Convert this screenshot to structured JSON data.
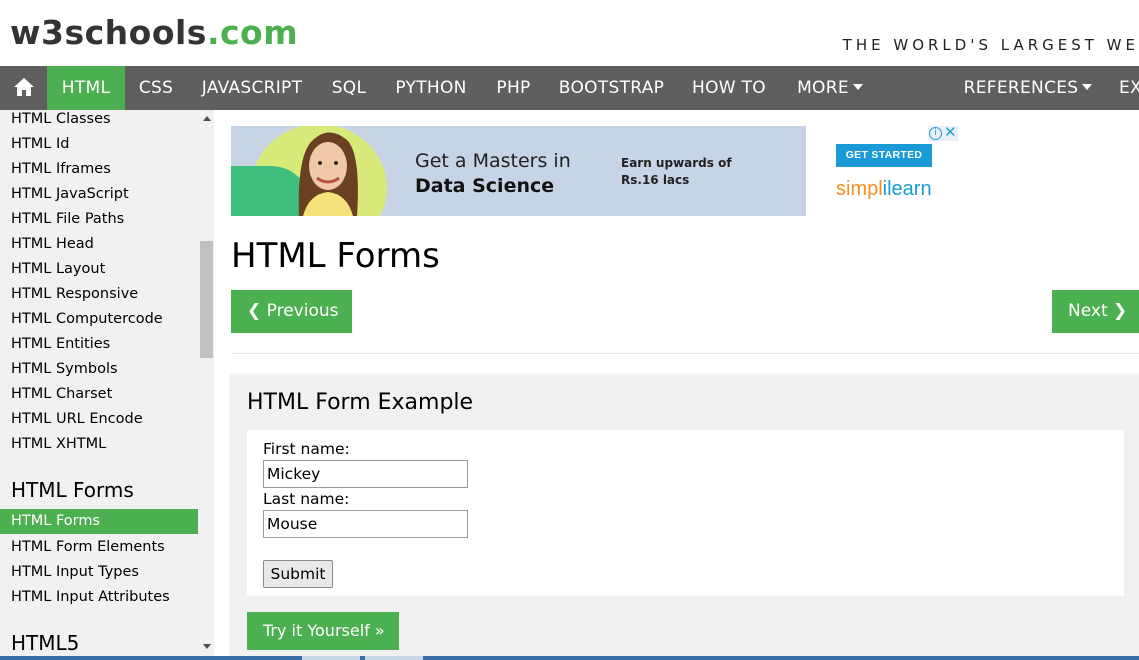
{
  "brand": {
    "logo_main": "w3schools",
    "logo_suffix": ".com",
    "tagline": "THE WORLD'S LARGEST WE"
  },
  "nav": {
    "home_icon": "home-icon",
    "items": [
      {
        "label": "HTML",
        "active": true
      },
      {
        "label": "CSS"
      },
      {
        "label": "JAVASCRIPT"
      },
      {
        "label": "SQL"
      },
      {
        "label": "PYTHON"
      },
      {
        "label": "PHP"
      },
      {
        "label": "BOOTSTRAP"
      },
      {
        "label": "HOW TO"
      },
      {
        "label": "MORE"
      },
      {
        "label": "REFERENCES"
      },
      {
        "label": "EX"
      }
    ]
  },
  "sidebar": {
    "links_top": [
      "HTML Classes",
      "HTML Id",
      "HTML Iframes",
      "HTML JavaScript",
      "HTML File Paths",
      "HTML Head",
      "HTML Layout",
      "HTML Responsive",
      "HTML Computercode",
      "HTML Entities",
      "HTML Symbols",
      "HTML Charset",
      "HTML URL Encode",
      "HTML XHTML"
    ],
    "forms_heading": "HTML Forms",
    "forms_links": [
      "HTML Forms",
      "HTML Form Elements",
      "HTML Input Types",
      "HTML Input Attributes"
    ],
    "active_link": "HTML Forms",
    "html5_heading": "HTML5"
  },
  "ad": {
    "headline": "Get a Masters in",
    "subject": "Data Science",
    "earn_line1": "Earn upwards of",
    "earn_line2": "Rs.16 lacs",
    "cta": "GET STARTED",
    "brand_part1": "simpl",
    "brand_part2": "ilearn",
    "info_glyph": "i",
    "close_glyph": "✕"
  },
  "main": {
    "title": "HTML Forms",
    "prev_label": "❮ Previous",
    "next_label": "Next ❯"
  },
  "example": {
    "title": "HTML Form Example",
    "first_name_label": "First name:",
    "first_name_value": "Mickey",
    "last_name_label": "Last name:",
    "last_name_value": "Mouse",
    "submit_label": "Submit",
    "try_label": "Try it Yourself »"
  },
  "colors": {
    "accent": "#4CAF50",
    "nav_bg": "#5f5f5f",
    "sidebar_bg": "#f1f1f1"
  }
}
